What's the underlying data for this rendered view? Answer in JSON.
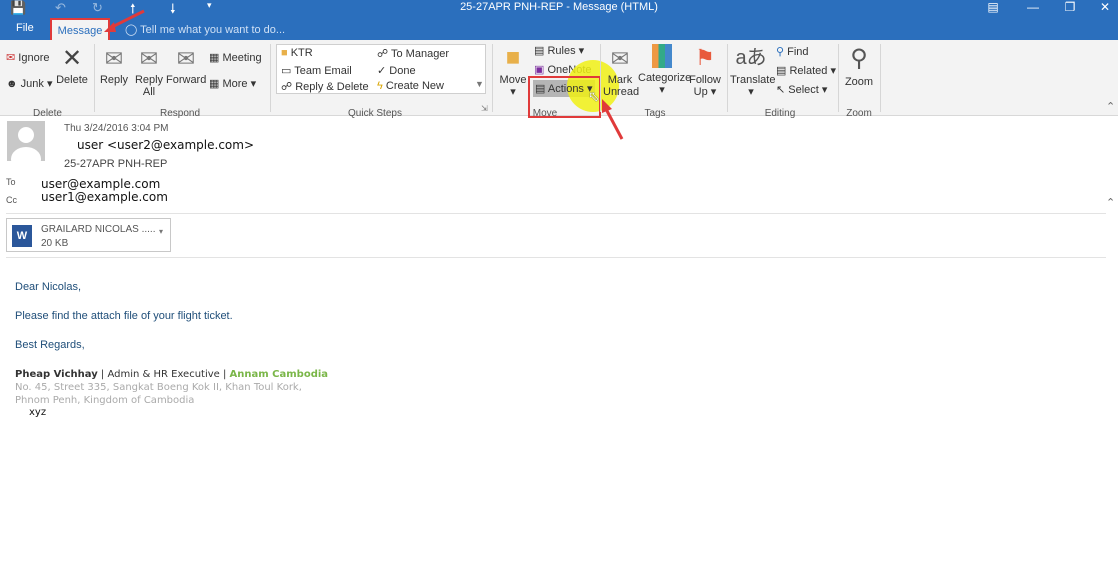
{
  "window": {
    "title": "25-27APR PNH-REP - Message (HTML)"
  },
  "quick_access": [
    "save-icon",
    "undo-icon",
    "redo-icon",
    "up-icon",
    "down-icon",
    "customize-icon"
  ],
  "tabs": {
    "file": "File",
    "message": "Message",
    "tell_me": "Tell me what you want to do..."
  },
  "ribbon": {
    "delete": {
      "label": "Delete",
      "ignore": "Ignore",
      "junk": "Junk",
      "delete": "Delete"
    },
    "respond": {
      "label": "Respond",
      "reply": "Reply",
      "reply_all_1": "Reply",
      "reply_all_2": "All",
      "forward": "Forward",
      "meeting": "Meeting",
      "more": "More"
    },
    "quick_steps": {
      "label": "Quick Steps",
      "items": [
        "KTR",
        "To Manager",
        "Team Email",
        "Done",
        "Reply & Delete",
        "Create New"
      ]
    },
    "move": {
      "label": "Move",
      "move": "Move",
      "rules": "Rules",
      "onenote": "OneNote",
      "actions": "Actions"
    },
    "tags": {
      "label": "Tags",
      "mark_1": "Mark",
      "mark_2": "Unread",
      "categorize": "Categorize",
      "follow_1": "Follow",
      "follow_2": "Up"
    },
    "editing": {
      "label": "Editing",
      "translate": "Translate",
      "find": "Find",
      "related": "Related",
      "select": "Select"
    },
    "zoom": {
      "label": "Zoom",
      "zoom": "Zoom"
    }
  },
  "message": {
    "date": "Thu 3/24/2016 3:04 PM",
    "from": "user <user2@example.com>",
    "subject": "25-27APR PNH-REP",
    "to_label": "To",
    "to": "user@example.com",
    "cc_label": "Cc",
    "cc": "user1@example.com",
    "attachment": {
      "name": "GRAILARD NICOLAS .....",
      "size": "20 KB"
    },
    "body": {
      "greeting": "Dear Nicolas,",
      "line1": "Please find the attach file of your flight ticket.",
      "closing": "Best Regards,",
      "sig_name": "Pheap Vichhay",
      "sig_title": " | Admin & HR Executive | ",
      "sig_company": "Annam Cambodia",
      "address1": "No. 45, Street 335, Sangkat Boeng Kok II, Khan Toul Kork,",
      "address2": "Phnom Penh, Kingdom of Cambodia",
      "extra": "xyz"
    }
  },
  "colors": {
    "brand": "#2b6fbd",
    "highlight": "#e03a3a",
    "company": "#7ab648"
  }
}
